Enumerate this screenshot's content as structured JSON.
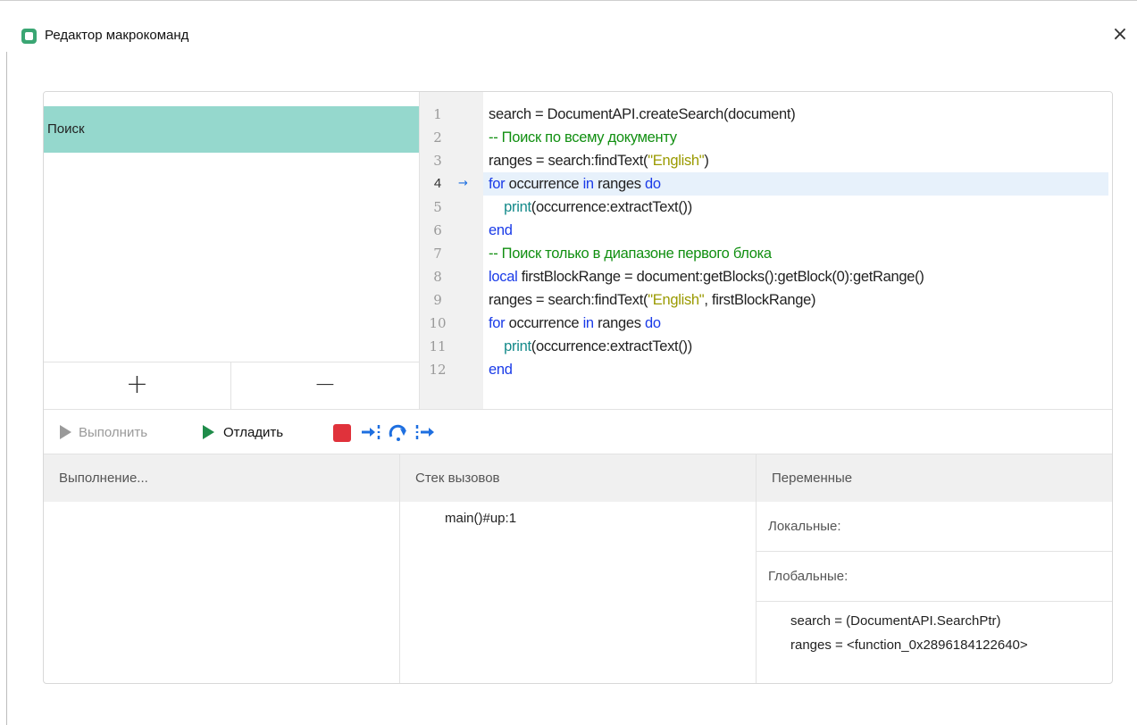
{
  "window": {
    "title": "Редактор макрокоманд",
    "close_label": "×"
  },
  "macros": {
    "items": [
      {
        "label": "Поиск",
        "selected": true
      }
    ],
    "add_label": "+",
    "remove_label": "−"
  },
  "editor": {
    "current_line": 4,
    "line_numbers": [
      "1",
      "2",
      "3",
      "4",
      "5",
      "6",
      "7",
      "8",
      "9",
      "10",
      "11",
      "12"
    ],
    "lines": [
      [
        {
          "t": "search = DocumentAPI.createSearch(document)",
          "c": ""
        }
      ],
      [
        {
          "t": "-- Поиск по всему документу",
          "c": "cmt"
        }
      ],
      [
        {
          "t": "ranges = search:findText(",
          "c": ""
        },
        {
          "t": "\"English\"",
          "c": "str"
        },
        {
          "t": ")",
          "c": ""
        }
      ],
      [
        {
          "t": "for",
          "c": "kw"
        },
        {
          "t": " occurrence ",
          "c": ""
        },
        {
          "t": "in",
          "c": "kw"
        },
        {
          "t": " ranges ",
          "c": ""
        },
        {
          "t": "do",
          "c": "kw"
        }
      ],
      [
        {
          "t": "    ",
          "c": ""
        },
        {
          "t": "print",
          "c": "fn"
        },
        {
          "t": "(occurrence:extractText())",
          "c": ""
        }
      ],
      [
        {
          "t": "end",
          "c": "kw"
        }
      ],
      [
        {
          "t": "-- Поиск только в диапазоне первого блока",
          "c": "cmt"
        }
      ],
      [
        {
          "t": "local",
          "c": "kw"
        },
        {
          "t": " firstBlockRange = document:getBlocks():getBlock(0):getRange()",
          "c": ""
        }
      ],
      [
        {
          "t": "ranges = search:findText(",
          "c": ""
        },
        {
          "t": "\"English\"",
          "c": "str"
        },
        {
          "t": ", firstBlockRange)",
          "c": ""
        }
      ],
      [
        {
          "t": "for",
          "c": "kw"
        },
        {
          "t": " occurrence ",
          "c": ""
        },
        {
          "t": "in",
          "c": "kw"
        },
        {
          "t": " ranges ",
          "c": ""
        },
        {
          "t": "do",
          "c": "kw"
        }
      ],
      [
        {
          "t": "    ",
          "c": ""
        },
        {
          "t": "print",
          "c": "fn"
        },
        {
          "t": "(occurrence:extractText())",
          "c": ""
        }
      ],
      [
        {
          "t": "end",
          "c": "kw"
        }
      ]
    ]
  },
  "toolbar": {
    "run_label": "Выполнить",
    "debug_label": "Отладить",
    "icons": [
      "stop-icon",
      "step-into-icon",
      "step-over-icon",
      "step-out-icon"
    ]
  },
  "panels": {
    "execution": {
      "header": "Выполнение..."
    },
    "call_stack": {
      "header": "Стек вызовов",
      "entries": [
        "main()#up:1"
      ]
    },
    "variables": {
      "header": "Переменные",
      "locals_label": "Локальные:",
      "globals_label": "Глобальные:",
      "globals": [
        "search = (DocumentAPI.SearchPtr)",
        "ranges = <function_0x2896184122640>"
      ]
    }
  },
  "colors": {
    "accent": "#95d8cd",
    "keyword": "#1a3be8",
    "string": "#9a9a00",
    "comment": "#118f11",
    "builtin": "#148a8a",
    "stop": "#e0323b",
    "step": "#1e6fe0"
  }
}
